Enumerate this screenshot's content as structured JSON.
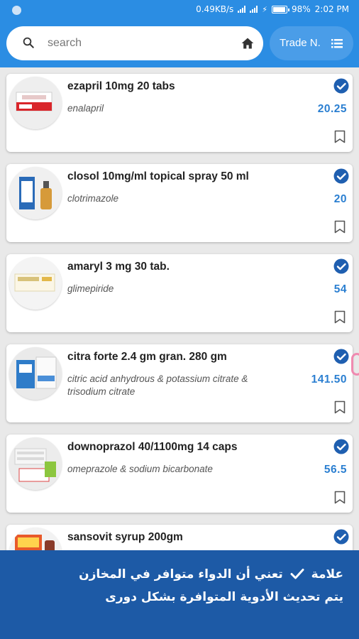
{
  "status_bar": {
    "speed": "0.49KB/s",
    "battery": "98%",
    "time": "2:02 PM"
  },
  "search": {
    "placeholder": "search",
    "value": ""
  },
  "filter": {
    "label": "Trade N."
  },
  "colors": {
    "primary": "#2b8de3",
    "accent": "#2b7fd1",
    "banner": "#1d5aa6"
  },
  "products": [
    {
      "name": "ezapril 10mg 20 tabs",
      "generic": "enalapril",
      "price": "20.25",
      "available": true
    },
    {
      "name": "closol 10mg/ml topical spray 50 ml",
      "generic": "clotrimazole",
      "price": "20",
      "available": true
    },
    {
      "name": "amaryl 3 mg 30 tab.",
      "generic": "glimepiride",
      "price": "54",
      "available": true
    },
    {
      "name": "citra forte 2.4 gm gran. 280 gm",
      "generic": "citric acid anhydrous & potassium citrate & trisodium citrate",
      "price": "141.50",
      "available": true
    },
    {
      "name": "downoprazol 40/1100mg 14 caps",
      "generic": "omeprazole & sodium bicarbonate",
      "price": "56.5",
      "available": true
    },
    {
      "name": "sansovit syrup 200gm",
      "generic": "",
      "price": "",
      "available": true
    }
  ],
  "banner": {
    "line1_prefix": "علامة",
    "line1_suffix": "تعني أن الدواء متوافر في المخازن",
    "line2": "يتم تحديث الأدوية المتوافرة بشكل دورى"
  }
}
